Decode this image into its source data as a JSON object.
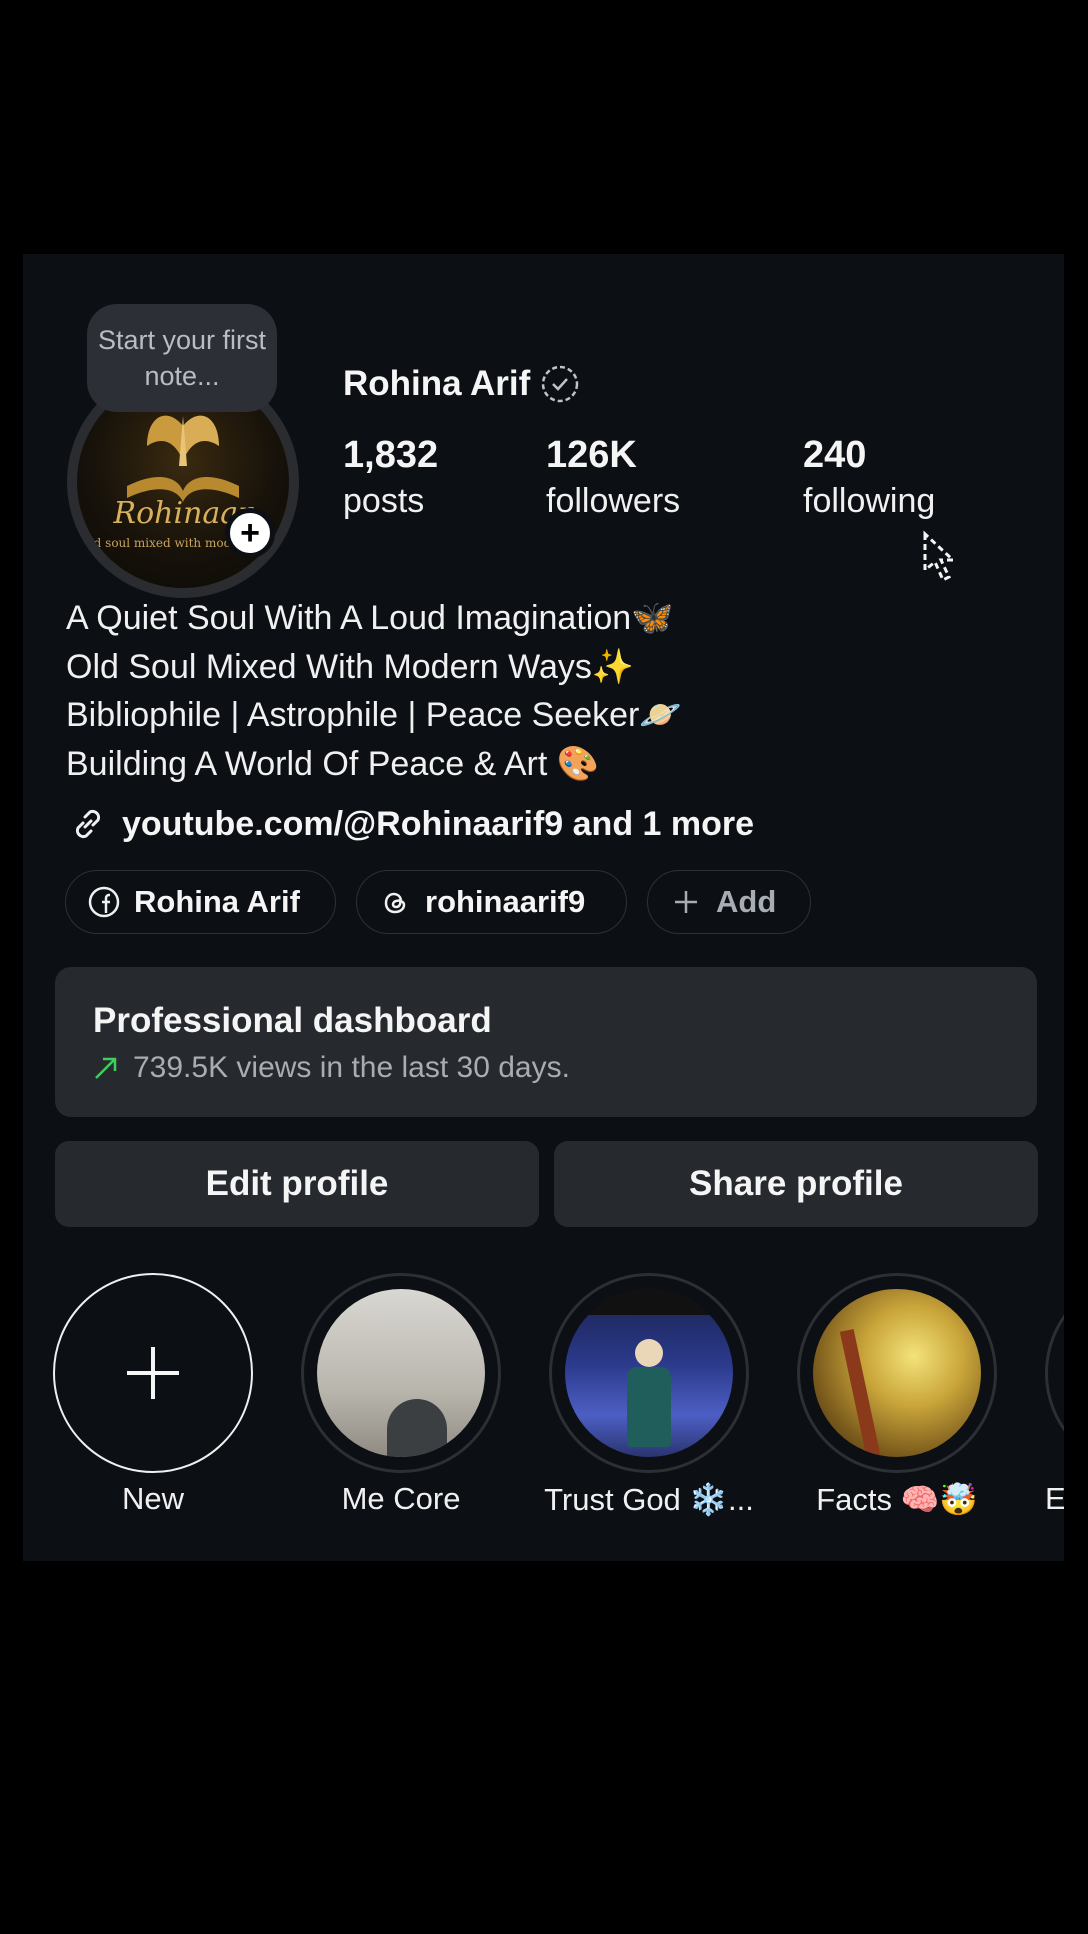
{
  "profile": {
    "note_placeholder": "Start your first note...",
    "name": "Rohina Arif",
    "avatar_text": "Rohinaar",
    "avatar_subtext": "Old soul mixed with modern ways",
    "stats": [
      {
        "value": "1,832",
        "label": "posts"
      },
      {
        "value": "126K",
        "label": "followers"
      },
      {
        "value": "240",
        "label": "following"
      }
    ],
    "bio": [
      "A Quiet Soul With A Loud Imagination🦋",
      "Old Soul Mixed With Modern Ways✨",
      "Bibliophile | Astrophile | Peace Seeker🪐",
      "Building A World Of Peace & Art 🎨"
    ],
    "link": "youtube.com/@Rohinaarif9 and 1 more",
    "chips": [
      {
        "icon": "facebook-icon",
        "label": "Rohina Arif"
      },
      {
        "icon": "threads-icon",
        "label": "rohinaarif9"
      },
      {
        "icon": "plus-icon",
        "label": "Add"
      }
    ]
  },
  "dashboard": {
    "title": "Professional dashboard",
    "subtitle": "739.5K views in the last 30 days.",
    "trend_color": "#3ecf5e"
  },
  "buttons": {
    "edit": "Edit profile",
    "share": "Share profile"
  },
  "highlights": [
    {
      "label": "New"
    },
    {
      "label": "Me Core"
    },
    {
      "label": "Trust God ❄️..."
    },
    {
      "label": "Facts 🧠🤯"
    },
    {
      "label": "Elo"
    }
  ]
}
